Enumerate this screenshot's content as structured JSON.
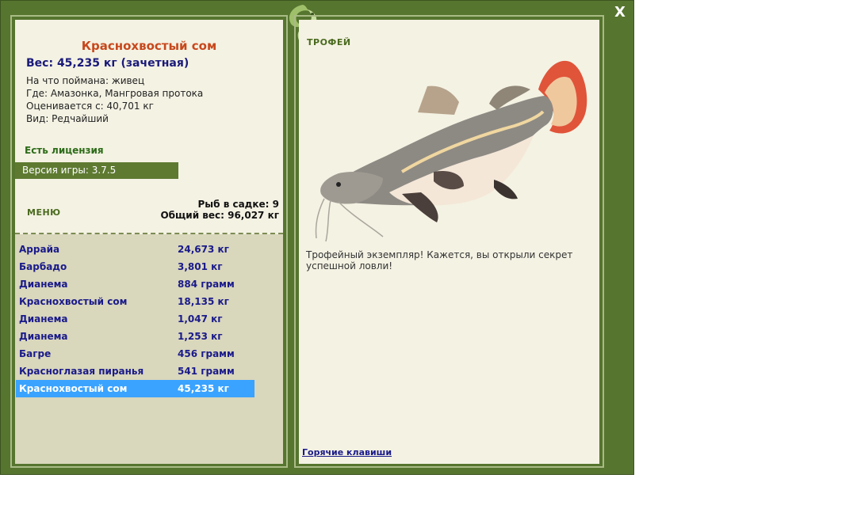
{
  "window": {
    "close_label": "X"
  },
  "fish": {
    "name": "Краснохвостый сом",
    "weight_line": "Вес: 45,235 кг (зачетная)",
    "bait_line": "На что поймана: живец",
    "location_line": "Где: Амазонка, Мангровая протока",
    "threshold_line": "Оценивается с: 40,701 кг",
    "rarity_line": "Вид: Редчайший"
  },
  "license_text": "Есть лицензия",
  "version_text": "Версия игры: 3.7.5",
  "menu_label": "МЕНЮ",
  "stats": {
    "count_line": "Рыб в садке: 9",
    "total_line": "Общий вес: 96,027 кг"
  },
  "catch_list": [
    {
      "name": "Аррайа",
      "weight": "24,673 кг"
    },
    {
      "name": "Барбадо",
      "weight": "3,801 кг"
    },
    {
      "name": "Дианема",
      "weight": "884 грамм"
    },
    {
      "name": "Краснохвостый сом",
      "weight": "18,135 кг"
    },
    {
      "name": "Дианема",
      "weight": "1,047 кг"
    },
    {
      "name": "Дианема",
      "weight": "1,253 кг"
    },
    {
      "name": "Багре",
      "weight": "456 грамм"
    },
    {
      "name": "Красноглазая пиранья",
      "weight": "541 грамм"
    },
    {
      "name": "Краснохвостый сом",
      "weight": "45,235 кг"
    }
  ],
  "selected_catch_index": 8,
  "trophy": {
    "label": "ТРОФЕЙ",
    "description": "Трофейный экземпляр! Кажется, вы открыли секрет успешной ловли!"
  },
  "hotkeys_label": "Горячие клавиши",
  "colors": {
    "frame": "#56752f",
    "panel": "#f4f2e3",
    "list_background": "#d9d7bc",
    "selection": "#3aa3ff",
    "fish_name": "#c8481c",
    "list_text": "#1a1a8a"
  }
}
